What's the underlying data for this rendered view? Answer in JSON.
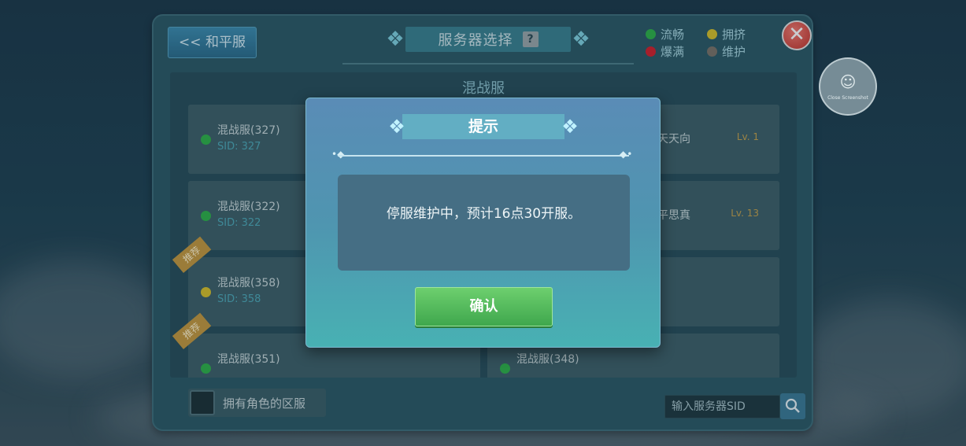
{
  "panel": {
    "back_label": "<< 和平服",
    "title": "服务器选择",
    "help_icon": "?",
    "close_icon": "✕",
    "legend": [
      {
        "label": "流畅",
        "color": "#2fb24a"
      },
      {
        "label": "拥挤",
        "color": "#d8c12b"
      },
      {
        "label": "爆满",
        "color": "#d2222e"
      },
      {
        "label": "维护",
        "color": "#7b746a"
      }
    ]
  },
  "list": {
    "header": "混战服",
    "servers": [
      {
        "name": "混战服(327)",
        "sid": "SID: 327",
        "status_color": "#2fb24a",
        "role": "天天向",
        "level": "Lv. 1",
        "badge": ""
      },
      {
        "name": "混战服(322)",
        "sid": "SID: 322",
        "status_color": "#2fb24a",
        "role": "平思真",
        "level": "Lv. 13",
        "badge": ""
      },
      {
        "name": "混战服(358)",
        "sid": "SID: 358",
        "status_color": "#d8c12b",
        "role": "",
        "level": "",
        "badge": "推荐"
      },
      {
        "name": "混战服(351)",
        "sid": "",
        "status_color": "#2fb24a",
        "role": "",
        "level": "",
        "badge": "推荐"
      },
      {
        "name": "混战服(348)",
        "sid": "",
        "status_color": "#2fb24a",
        "role": "",
        "level": "",
        "badge": ""
      }
    ]
  },
  "footer": {
    "own_roles_label": "拥有角色的区服",
    "sid_input_placeholder": "输入服务器SID",
    "search_icon": "search-icon"
  },
  "screenshot": {
    "icon": "☺",
    "label": "Close Screenshot"
  },
  "dialog": {
    "title": "提示",
    "message": "停服维护中，预计16点30开服。",
    "confirm_label": "确认"
  }
}
